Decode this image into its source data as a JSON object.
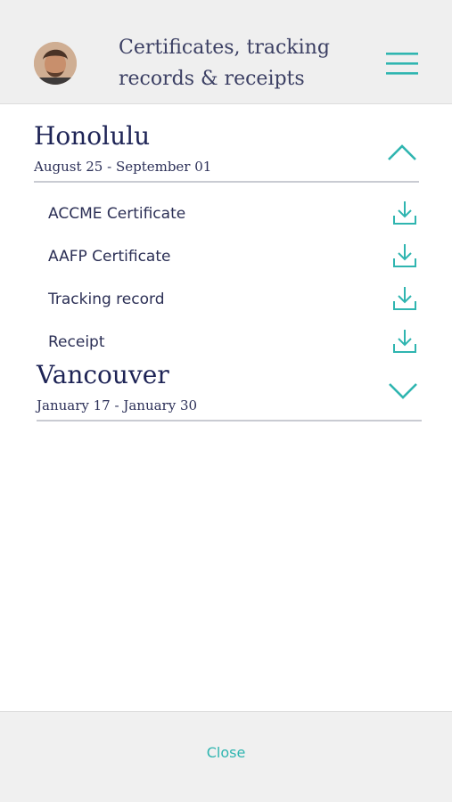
{
  "header": {
    "title_line1": "Certificates, tracking",
    "title_line2": "records & receipts",
    "avatar_icon": "user-avatar",
    "menu_icon": "hamburger-menu-icon"
  },
  "sections": [
    {
      "title": "Honolulu",
      "dates": "August 25 - September 01",
      "expanded": true,
      "items": [
        {
          "label": "ACCME Certificate"
        },
        {
          "label": "AAFP Certificate"
        },
        {
          "label": "Tracking record"
        },
        {
          "label": "Receipt"
        }
      ]
    },
    {
      "title": "Vancouver",
      "dates": "January 17 - January 30",
      "expanded": false,
      "items": []
    }
  ],
  "footer": {
    "close_label": "Close"
  },
  "colors": {
    "accent": "#2fb5b0",
    "text": "#23275a",
    "header_bg": "#efefef"
  }
}
